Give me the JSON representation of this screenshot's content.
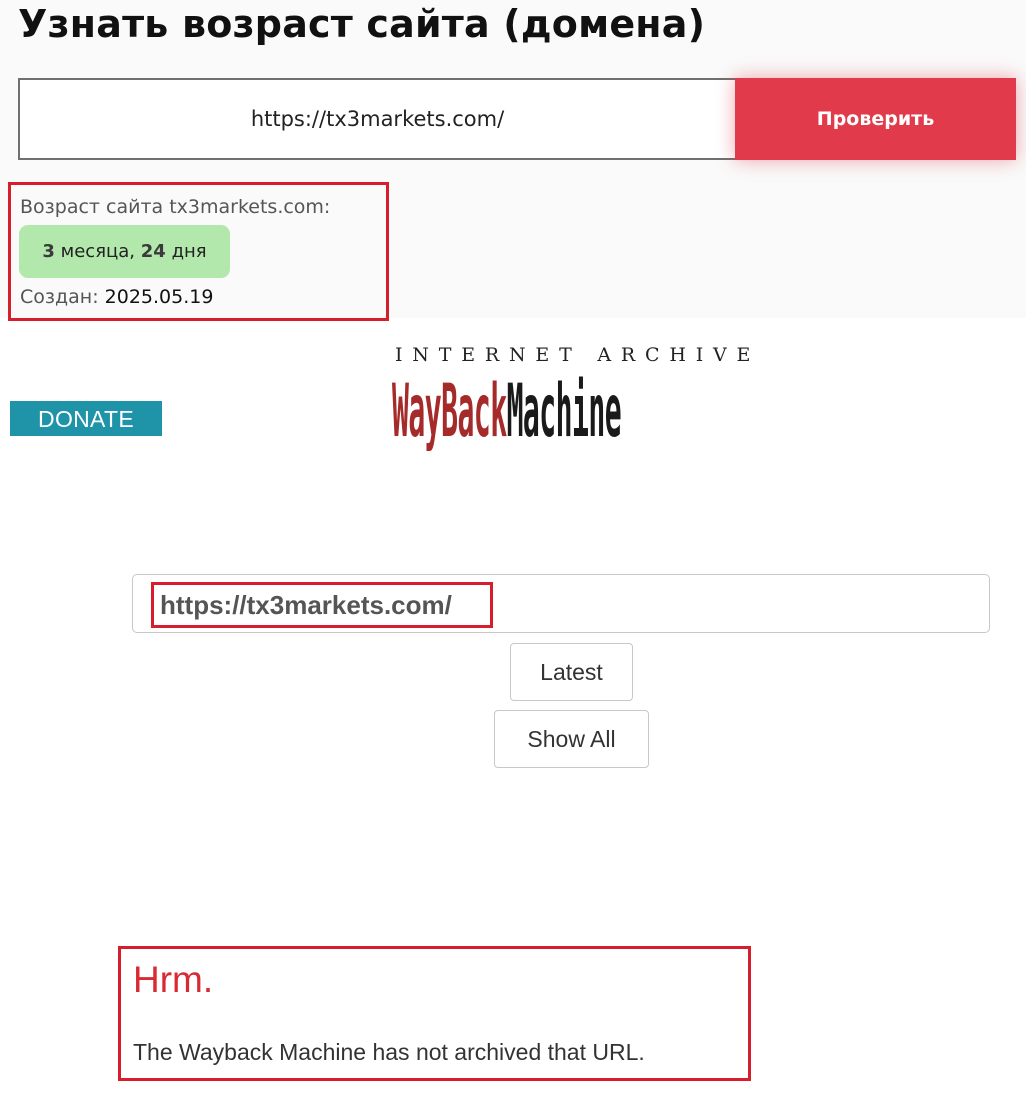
{
  "header": {
    "title": "Узнать возраст сайта (домена)"
  },
  "checker": {
    "url_value": "https://tx3markets.com/",
    "check_label": "Проверить",
    "accent_color": "#e13b4b"
  },
  "result": {
    "age_label": "Возраст сайта tx3markets.com:",
    "age_months_num": "3",
    "age_months_word": "месяца,",
    "age_days_num": "24",
    "age_days_word": "дня",
    "created_label": "Создан:",
    "created_date": "2025.05.19",
    "highlight_color": "#d61f2c"
  },
  "wayback": {
    "donate_label": "DONATE",
    "logo_top": "INTERNET ARCHIVE",
    "logo_wayback": "WayBack",
    "logo_machine": "Machine",
    "search_url": "https://tx3markets.com/",
    "latest_label": "Latest",
    "show_all_label": "Show All"
  },
  "error": {
    "title": "Hrm.",
    "message": "The Wayback Machine has not archived that URL."
  }
}
